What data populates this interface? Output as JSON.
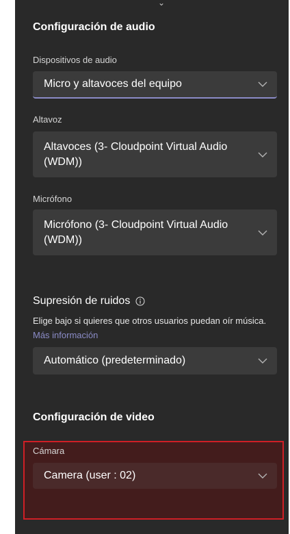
{
  "audio_settings": {
    "title": "Configuración de audio",
    "devices_label": "Dispositivos de audio",
    "devices_value": "Micro y altavoces del equipo",
    "speaker_label": "Altavoz",
    "speaker_value": "Altavoces (3- Cloudpoint Virtual Audio (WDM))",
    "mic_label": "Micrófono",
    "mic_value": "Micrófono (3- Cloudpoint Virtual Audio (WDM))"
  },
  "noise": {
    "title": "Supresión de ruidos",
    "description": "Elige bajo si quieres que otros usuarios puedan oír música.",
    "link": "Más información",
    "value": "Automático (predeterminado)"
  },
  "video_settings": {
    "title": "Configuración de video",
    "camera_label": "Cámara",
    "camera_value": "Camera (user : 02)"
  },
  "icons": {
    "dropdown": "chevron-down-icon",
    "info": "info-circle-icon",
    "top": "chevron-down-icon"
  },
  "colors": {
    "panel_bg": "#292929",
    "field_bg": "#3b3b3b",
    "accent": "#8b8cc7",
    "highlight_border": "#d01f26"
  }
}
